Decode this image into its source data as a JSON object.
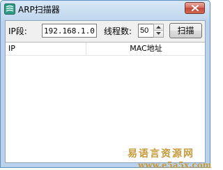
{
  "window": {
    "title": "ARP扫描器",
    "icon": "app-icon",
    "close_icon": "close-icon"
  },
  "form": {
    "ip_label": "IP段:",
    "ip_value": "192.168.1.0",
    "threads_label": "线程数:",
    "threads_value": "50",
    "scan_button": "扫描"
  },
  "list": {
    "columns": [
      "IP",
      "MAC地址"
    ],
    "rows": []
  },
  "watermark": {
    "name": "易语言资源网",
    "url": "www.e5a5x.com"
  },
  "colors": {
    "titlebar": "#c4d9ef",
    "close_button": "#c24a3a",
    "watermark": "#c79a3a"
  }
}
